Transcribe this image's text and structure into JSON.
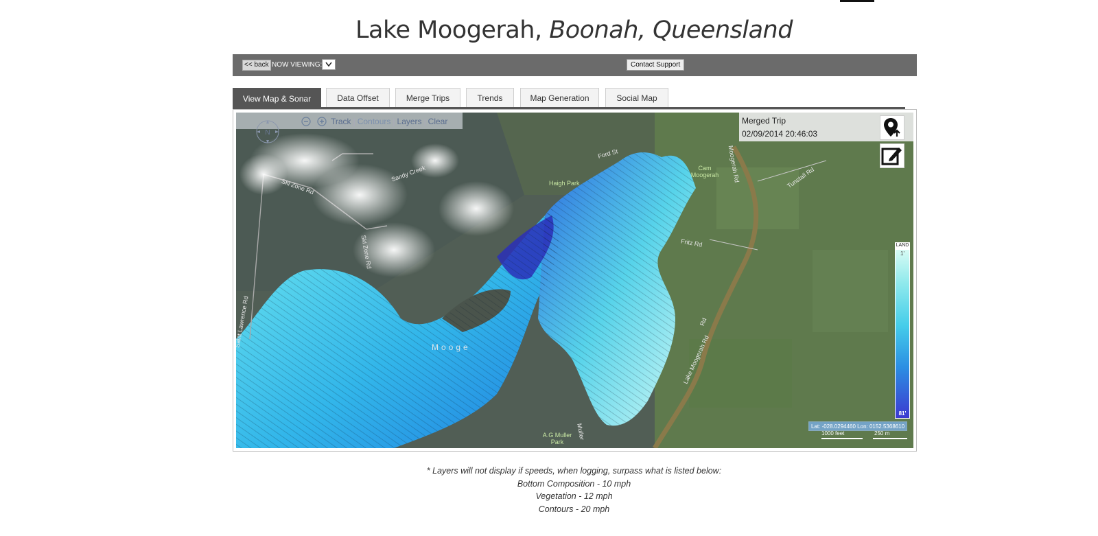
{
  "header": {
    "title_main": "Lake Moogerah,",
    "title_sub": "Boonah, Queensland"
  },
  "toolbar": {
    "back_label": "<< back",
    "now_viewing_label": "NOW VIEWING:",
    "contact_label": "Contact Support"
  },
  "tabs": [
    {
      "label": "View Map & Sonar",
      "active": true
    },
    {
      "label": "Data Offset",
      "active": false
    },
    {
      "label": "Merge Trips",
      "active": false
    },
    {
      "label": "Trends",
      "active": false
    },
    {
      "label": "Map Generation",
      "active": false
    },
    {
      "label": "Social Map",
      "active": false
    }
  ],
  "map": {
    "compass_label": "N",
    "links": {
      "track": "Track",
      "contours": "Contours",
      "layers": "Layers",
      "clear": "Clear"
    },
    "trip": {
      "name": "Merged Trip",
      "date": "02/09/2014 20:46:03"
    },
    "legend": {
      "land_label": "LAND",
      "min": "1'",
      "max": "81'"
    },
    "coords": "Lat: -028.0294460 Lon: 0152.5368610",
    "scale": {
      "feet": "1000 feet",
      "meters": "250 m"
    },
    "place_labels": {
      "ski_zone_rd": "Ski Zone Rd",
      "sandy_creek": "Sandy Creek",
      "ski_zone_rd2": "Ski Zone Rd",
      "saint_lawrence_rd": "Saint Lawrence Rd",
      "haigh_park": "Haigh Park",
      "ford_st": "Ford St",
      "cam_moogerah": "Cam Moogerah",
      "moogerah_rd": "Moogerah Rd",
      "tunstall_rd": "Tunstall Rd",
      "fritz_rd": "Fritz Rd",
      "lake_moogerah_rd": "Lake Moogerah Rd",
      "rd": "Rd",
      "ag_muller_park": "A.G Muller Park",
      "muller": "Muller",
      "lake_name": "Mooge"
    }
  },
  "notes": [
    "* Layers will not display if speeds, when logging, surpass what is listed below:",
    "Bottom Composition - 10 mph",
    "Vegetation - 12 mph",
    "Contours - 20 mph"
  ],
  "colors": {
    "toolbar_bg": "#6b6b6b",
    "active_tab_bg": "#555555",
    "depth_shallow": "#d7fbf4",
    "depth_deep": "#3c3ad0"
  },
  "icons": {
    "compass": "compass-icon",
    "zoom_out": "zoom-out-icon",
    "zoom_in": "zoom-in-icon",
    "pin": "map-pin-icon",
    "edit": "edit-icon",
    "dropdown": "chevron-down-icon"
  }
}
